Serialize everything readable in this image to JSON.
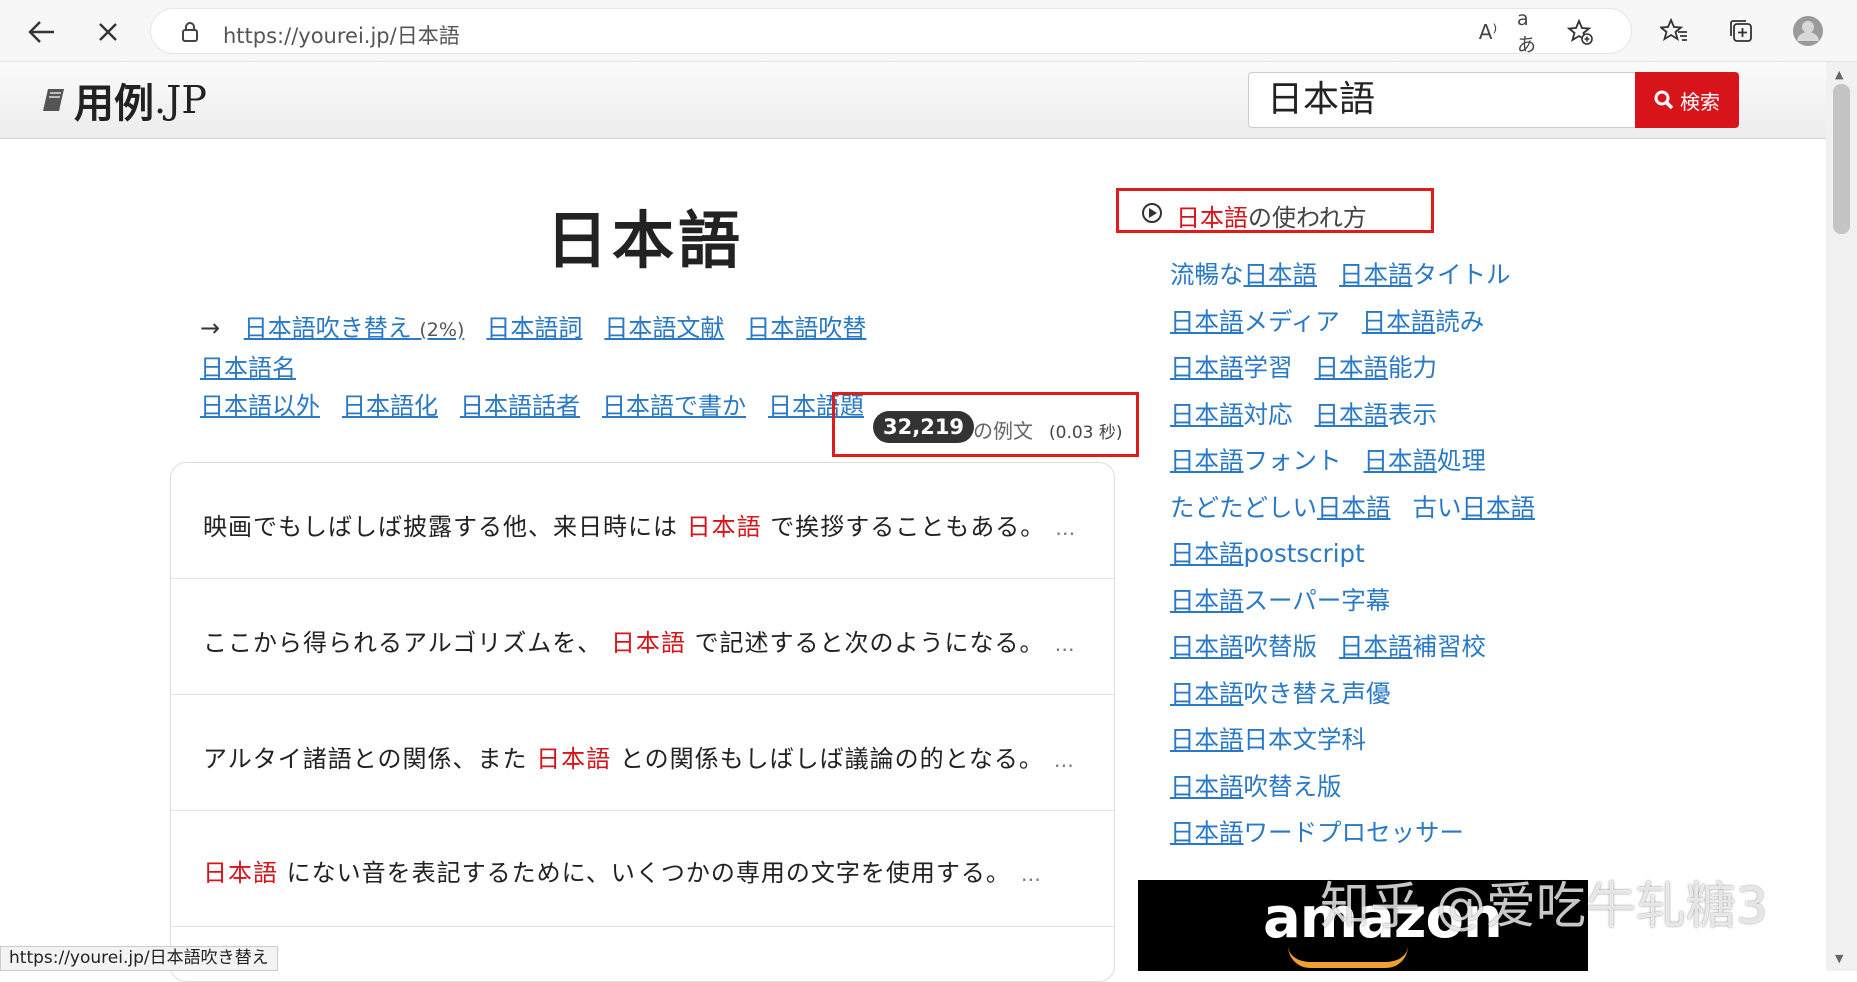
{
  "browser": {
    "url": "https://yourei.jp/日本語",
    "read_aloud_icon": "A⁾",
    "translate_icon": "aあ"
  },
  "site": {
    "logo": "用例",
    "logo_suffix": ".JP",
    "search_value": "日本語",
    "search_button": "検索"
  },
  "main": {
    "title": "日本語",
    "arrow": "→",
    "related": [
      {
        "hl": "日本語",
        "rest": "吹き替え",
        "pct": "(2%)"
      },
      {
        "hl": "日本語",
        "rest": "詞"
      },
      {
        "hl": "日本語",
        "rest": "文献"
      },
      {
        "hl": "日本語",
        "rest": "吹替"
      },
      {
        "hl": "日本語",
        "rest": "名"
      },
      {
        "hl": "日本語",
        "rest": "以外"
      },
      {
        "hl": "日本語",
        "rest": "化"
      },
      {
        "hl": "日本語",
        "rest": "話者"
      },
      {
        "hl": "日本語",
        "rest": "で書か"
      },
      {
        "hl": "日本語",
        "rest": "題"
      }
    ],
    "count": "32,219",
    "count_label": "の例文",
    "count_time": "(0.03 秒)",
    "examples": [
      {
        "before": "映画でもしばしば披露する他、来日時には",
        "hl": "日本語",
        "after": "で挨拶することもある。",
        "more": "…"
      },
      {
        "before": "ここから得られるアルゴリズムを、",
        "hl": "日本語",
        "after": "で記述すると次のようになる。",
        "more": "…"
      },
      {
        "before": "アルタイ諸語との関係、また",
        "hl": "日本語",
        "after": "との関係もしばしば議論の的となる。",
        "more": "…"
      },
      {
        "before": "",
        "hl": "日本語",
        "after": "にない音を表記するために、いくつかの専用の文字を使用する。",
        "more": "…"
      }
    ]
  },
  "status_url": "https://yourei.jp/日本語吹き替え",
  "side": {
    "usage_hl": "日本語",
    "usage_rest": "の使われ方",
    "rows": [
      [
        {
          "pre": "流暢な",
          "hl": "日本語",
          "post": ""
        },
        {
          "pre": "",
          "hl": "日本語",
          "post": "タイトル"
        }
      ],
      [
        {
          "pre": "",
          "hl": "日本語",
          "post": "メディア"
        },
        {
          "pre": "",
          "hl": "日本語",
          "post": "読み"
        }
      ],
      [
        {
          "pre": "",
          "hl": "日本語",
          "post": "学習"
        },
        {
          "pre": "",
          "hl": "日本語",
          "post": "能力"
        }
      ],
      [
        {
          "pre": "",
          "hl": "日本語",
          "post": "対応"
        },
        {
          "pre": "",
          "hl": "日本語",
          "post": "表示"
        }
      ],
      [
        {
          "pre": "",
          "hl": "日本語",
          "post": "フォント"
        },
        {
          "pre": "",
          "hl": "日本語",
          "post": "処理"
        }
      ],
      [
        {
          "pre": "たどたどしい",
          "hl": "日本語",
          "post": ""
        },
        {
          "pre": "古い",
          "hl": "日本語",
          "post": ""
        }
      ],
      [
        {
          "pre": "",
          "hl": "日本語",
          "post": "postscript"
        }
      ],
      [
        {
          "pre": "",
          "hl": "日本語",
          "post": "スーパー字幕"
        }
      ],
      [
        {
          "pre": "",
          "hl": "日本語",
          "post": "吹替版"
        },
        {
          "pre": "",
          "hl": "日本語",
          "post": "補習校"
        }
      ],
      [
        {
          "pre": "",
          "hl": "日本語",
          "post": "吹き替え声優"
        }
      ],
      [
        {
          "pre": "",
          "hl": "日本語",
          "post": "日本文学科"
        }
      ],
      [
        {
          "pre": "",
          "hl": "日本語",
          "post": "吹替え版"
        }
      ],
      [
        {
          "pre": "",
          "hl": "日本語",
          "post": "ワードプロセッサー"
        }
      ]
    ]
  },
  "ad": {
    "text": "amazon"
  },
  "watermark": "知乎 @爱吃牛轧糖3",
  "colors": {
    "accent": "#d7141a",
    "link": "#2979c6",
    "annotation": "#e21a1a"
  }
}
